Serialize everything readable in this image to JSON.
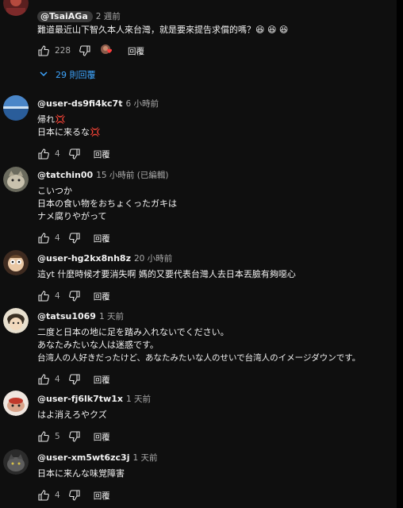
{
  "comments": [
    {
      "handle": "@TsaiAGa",
      "time": "2 週前",
      "lines": [
        "難道最近山下智久本人來台灣，就是要來提告求償的嗎？😆 😆 😆"
      ],
      "likes": "228",
      "reply_label": "回覆",
      "replies_link": "29 則回覆",
      "avatar_icon": "avatar-red",
      "heart_icon": "creator-heart-icon"
    },
    {
      "handle": "@user-ds9fi4kc7t",
      "time": "6 小時前",
      "lines": [
        "帰れ💢",
        "日本に来るな💢"
      ],
      "likes": "4",
      "reply_label": "回覆",
      "avatar_icon": "avatar-earth"
    },
    {
      "handle": "@tatchin00",
      "time": "15 小時前 (已編輯)",
      "lines": [
        "こいつか",
        "日本の食い物をおちょくったガキは",
        "ナメ腐りやがって"
      ],
      "likes": "4",
      "reply_label": "回覆",
      "avatar_icon": "avatar-cat"
    },
    {
      "handle": "@user-hg2kx8nh8z",
      "time": "20 小時前",
      "lines": [
        "這yt 什麼時候才要消失啊 媽的又要代表台灣人去日本丟臉有夠噁心"
      ],
      "likes": "4",
      "reply_label": "回覆",
      "avatar_icon": "avatar-cartoon"
    },
    {
      "handle": "@tatsu1069",
      "time": "1 天前",
      "lines": [
        "二度と日本の地に足を踏み入れないでください。",
        "あなたみたいな人は迷惑です。",
        "台湾人の人好きだったけど、あなたみたいな人のせいで台湾人のイメージダウンです。"
      ],
      "likes": "4",
      "reply_label": "回覆",
      "avatar_icon": "avatar-anime"
    },
    {
      "handle": "@user-fj6lk7tw1x",
      "time": "1 天前",
      "lines": [
        "はよ消えろやクズ"
      ],
      "likes": "5",
      "reply_label": "回覆",
      "avatar_icon": "avatar-mascot"
    },
    {
      "handle": "@user-xm5wt6zc3j",
      "time": "1 天前",
      "lines": [
        "日本に来んな味覚障害"
      ],
      "likes": "4",
      "reply_label": "回覆",
      "avatar_icon": "avatar-cat-dark"
    }
  ]
}
